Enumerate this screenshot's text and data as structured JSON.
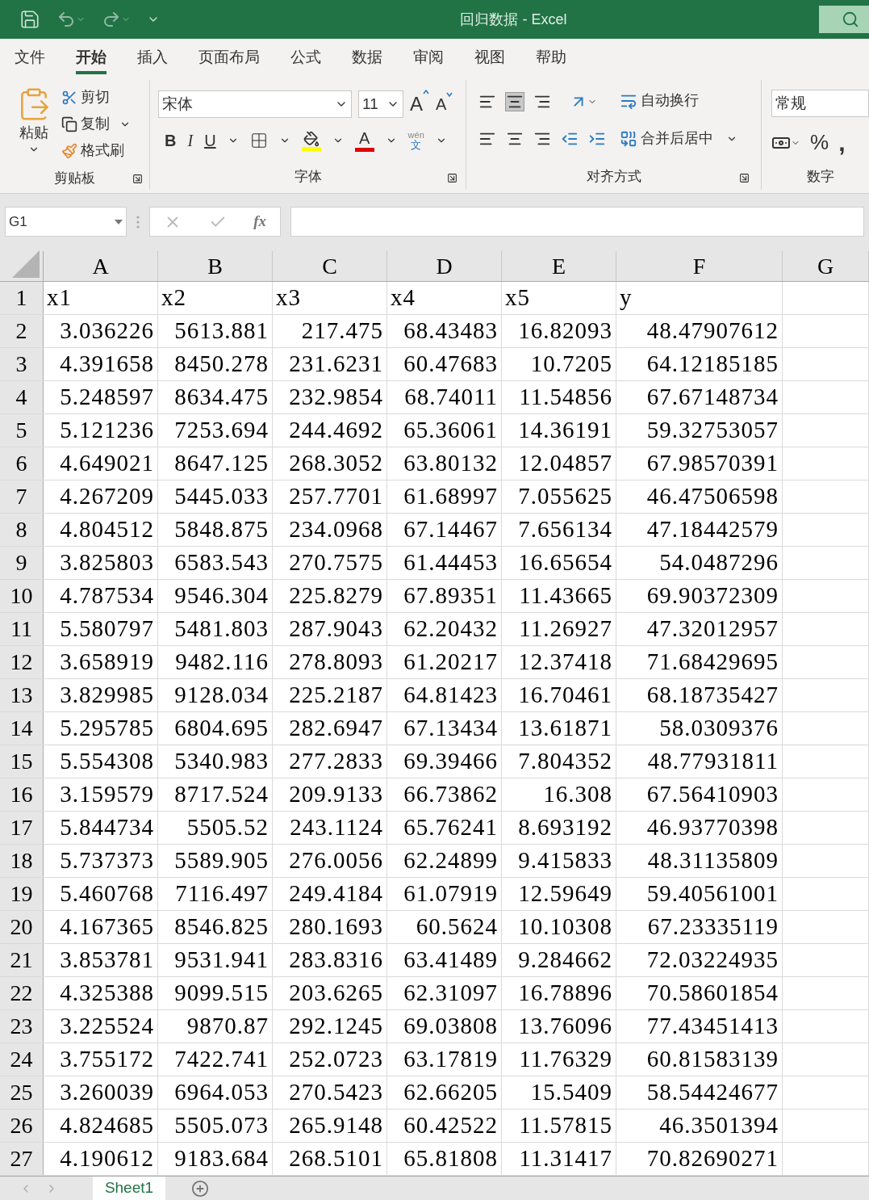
{
  "window": {
    "title": "回归数据  -  Excel"
  },
  "menu_tabs": [
    {
      "label": "文件",
      "selected": false
    },
    {
      "label": "开始",
      "selected": true
    },
    {
      "label": "插入",
      "selected": false
    },
    {
      "label": "页面布局",
      "selected": false
    },
    {
      "label": "公式",
      "selected": false
    },
    {
      "label": "数据",
      "selected": false
    },
    {
      "label": "审阅",
      "selected": false
    },
    {
      "label": "视图",
      "selected": false
    },
    {
      "label": "帮助",
      "selected": false
    }
  ],
  "ribbon": {
    "clipboard": {
      "paste": "粘贴",
      "cut": "剪切",
      "copy": "复制",
      "format_painter": "格式刷",
      "label": "剪贴板"
    },
    "font": {
      "name": "宋体",
      "size": "11",
      "grow": "A",
      "shrink": "A",
      "bold": "B",
      "italic": "I",
      "underline": "U",
      "font_color": "A",
      "phonetic_top": "wén",
      "phonetic_bottom": "文",
      "label": "字体"
    },
    "alignment": {
      "wrap_text": "自动换行",
      "merge_center": "合并后居中",
      "label": "对齐方式"
    },
    "number": {
      "format": "常规",
      "percent": "%",
      "comma": ",",
      "label": "数字"
    }
  },
  "formula_bar": {
    "name_box": "G1",
    "fx": "fx"
  },
  "columns": [
    "A",
    "B",
    "C",
    "D",
    "E",
    "F",
    "G"
  ],
  "rows": [
    {
      "number": "1",
      "kind": "text",
      "cells": [
        "x1",
        "x2",
        "x3",
        "x4",
        "x5",
        "y"
      ]
    },
    {
      "number": "2",
      "kind": "number",
      "cells": [
        "3.036226",
        "5613.881",
        "217.475",
        "68.43483",
        "16.82093",
        "48.47907612"
      ]
    },
    {
      "number": "3",
      "kind": "number",
      "cells": [
        "4.391658",
        "8450.278",
        "231.6231",
        "60.47683",
        "10.7205",
        "64.12185185"
      ]
    },
    {
      "number": "4",
      "kind": "number",
      "cells": [
        "5.248597",
        "8634.475",
        "232.9854",
        "68.74011",
        "11.54856",
        "67.67148734"
      ]
    },
    {
      "number": "5",
      "kind": "number",
      "cells": [
        "5.121236",
        "7253.694",
        "244.4692",
        "65.36061",
        "14.36191",
        "59.32753057"
      ]
    },
    {
      "number": "6",
      "kind": "number",
      "cells": [
        "4.649021",
        "8647.125",
        "268.3052",
        "63.80132",
        "12.04857",
        "67.98570391"
      ]
    },
    {
      "number": "7",
      "kind": "number",
      "cells": [
        "4.267209",
        "5445.033",
        "257.7701",
        "61.68997",
        "7.055625",
        "46.47506598"
      ]
    },
    {
      "number": "8",
      "kind": "number",
      "cells": [
        "4.804512",
        "5848.875",
        "234.0968",
        "67.14467",
        "7.656134",
        "47.18442579"
      ]
    },
    {
      "number": "9",
      "kind": "number",
      "cells": [
        "3.825803",
        "6583.543",
        "270.7575",
        "61.44453",
        "16.65654",
        "54.0487296"
      ]
    },
    {
      "number": "10",
      "kind": "number",
      "cells": [
        "4.787534",
        "9546.304",
        "225.8279",
        "67.89351",
        "11.43665",
        "69.90372309"
      ]
    },
    {
      "number": "11",
      "kind": "number",
      "cells": [
        "5.580797",
        "5481.803",
        "287.9043",
        "62.20432",
        "11.26927",
        "47.32012957"
      ]
    },
    {
      "number": "12",
      "kind": "number",
      "cells": [
        "3.658919",
        "9482.116",
        "278.8093",
        "61.20217",
        "12.37418",
        "71.68429695"
      ]
    },
    {
      "number": "13",
      "kind": "number",
      "cells": [
        "3.829985",
        "9128.034",
        "225.2187",
        "64.81423",
        "16.70461",
        "68.18735427"
      ]
    },
    {
      "number": "14",
      "kind": "number",
      "cells": [
        "5.295785",
        "6804.695",
        "282.6947",
        "67.13434",
        "13.61871",
        "58.0309376"
      ]
    },
    {
      "number": "15",
      "kind": "number",
      "cells": [
        "5.554308",
        "5340.983",
        "277.2833",
        "69.39466",
        "7.804352",
        "48.77931811"
      ]
    },
    {
      "number": "16",
      "kind": "number",
      "cells": [
        "3.159579",
        "8717.524",
        "209.9133",
        "66.73862",
        "16.308",
        "67.56410903"
      ]
    },
    {
      "number": "17",
      "kind": "number",
      "cells": [
        "5.844734",
        "5505.52",
        "243.1124",
        "65.76241",
        "8.693192",
        "46.93770398"
      ]
    },
    {
      "number": "18",
      "kind": "number",
      "cells": [
        "5.737373",
        "5589.905",
        "276.0056",
        "62.24899",
        "9.415833",
        "48.31135809"
      ]
    },
    {
      "number": "19",
      "kind": "number",
      "cells": [
        "5.460768",
        "7116.497",
        "249.4184",
        "61.07919",
        "12.59649",
        "59.40561001"
      ]
    },
    {
      "number": "20",
      "kind": "number",
      "cells": [
        "4.167365",
        "8546.825",
        "280.1693",
        "60.5624",
        "10.10308",
        "67.23335119"
      ]
    },
    {
      "number": "21",
      "kind": "number",
      "cells": [
        "3.853781",
        "9531.941",
        "283.8316",
        "63.41489",
        "9.284662",
        "72.03224935"
      ]
    },
    {
      "number": "22",
      "kind": "number",
      "cells": [
        "4.325388",
        "9099.515",
        "203.6265",
        "62.31097",
        "16.78896",
        "70.58601854"
      ]
    },
    {
      "number": "23",
      "kind": "number",
      "cells": [
        "3.225524",
        "9870.87",
        "292.1245",
        "69.03808",
        "13.76096",
        "77.43451413"
      ]
    },
    {
      "number": "24",
      "kind": "number",
      "cells": [
        "3.755172",
        "7422.741",
        "252.0723",
        "63.17819",
        "11.76329",
        "60.81583139"
      ]
    },
    {
      "number": "25",
      "kind": "number",
      "cells": [
        "3.260039",
        "6964.053",
        "270.5423",
        "62.66205",
        "15.5409",
        "58.54424677"
      ]
    },
    {
      "number": "26",
      "kind": "number",
      "cells": [
        "4.824685",
        "5505.073",
        "265.9148",
        "60.42522",
        "11.57815",
        "46.3501394"
      ]
    },
    {
      "number": "27",
      "kind": "number",
      "cells": [
        "4.190612",
        "9183.684",
        "268.5101",
        "65.81808",
        "11.31417",
        "70.82690271"
      ]
    }
  ],
  "sheet_tabs": [
    {
      "label": "Sheet1",
      "selected": true
    }
  ]
}
